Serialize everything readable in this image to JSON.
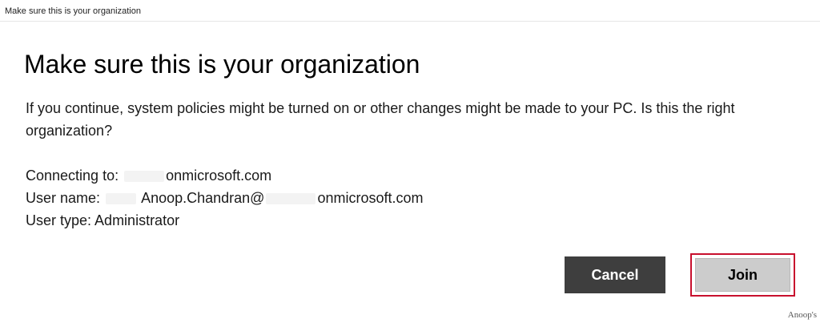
{
  "window": {
    "title": "Make sure this is your organization"
  },
  "dialog": {
    "heading": "Make sure this is your organization",
    "description": "If you continue, system policies might be turned on or other changes might be made to your PC. Is this the right organization?",
    "connecting_label": "Connecting to:",
    "connecting_value": "onmicrosoft.com",
    "username_label": "User name:",
    "username_value_prefix": "Anoop.Chandran@",
    "username_value_suffix": "onmicrosoft.com",
    "usertype_label": "User type:",
    "usertype_value": "Administrator"
  },
  "buttons": {
    "cancel_label": "Cancel",
    "join_label": "Join"
  },
  "watermark": {
    "text": "Anoop's"
  },
  "colors": {
    "cancel_bg": "#3e3e3e",
    "join_bg": "#cccccc",
    "highlight_border": "#c8102e"
  }
}
